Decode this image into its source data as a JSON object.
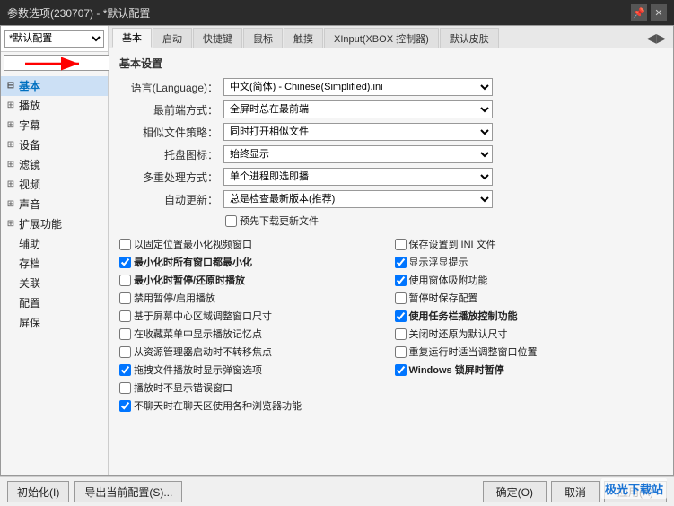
{
  "window": {
    "title": "参数选项(230707) - *默认配置",
    "controls": [
      "pin",
      "close"
    ]
  },
  "left_panel": {
    "profile_select": "*默认配置",
    "search_placeholder": "",
    "nav_items": [
      {
        "id": "basic",
        "label": "基本",
        "expanded": true,
        "selected": true
      },
      {
        "id": "playback",
        "label": "播放",
        "expanded": false
      },
      {
        "id": "subtitle",
        "label": "字幕",
        "expanded": false
      },
      {
        "id": "device",
        "label": "设备",
        "expanded": false
      },
      {
        "id": "filter",
        "label": "滤镜",
        "expanded": false
      },
      {
        "id": "video",
        "label": "视频",
        "expanded": false
      },
      {
        "id": "audio",
        "label": "声音",
        "expanded": false
      },
      {
        "id": "advanced",
        "label": "扩展功能",
        "expanded": false
      },
      {
        "id": "assist",
        "label": "辅助",
        "expanded": false
      },
      {
        "id": "save",
        "label": "存档",
        "expanded": false
      },
      {
        "id": "relate",
        "label": "关联",
        "expanded": false
      },
      {
        "id": "config",
        "label": "配置",
        "expanded": false
      },
      {
        "id": "screensaver",
        "label": "屏保",
        "expanded": false
      }
    ]
  },
  "right_panel": {
    "tabs": [
      "基本",
      "启动",
      "快捷键",
      "鼠标",
      "触摸",
      "XInput(XBOX 控制器)",
      "默认皮肤"
    ],
    "active_tab": "基本",
    "section_title": "基本设置",
    "form_rows": [
      {
        "label": "语言(Language)：",
        "value": "中文(简体) - Chinese(Simplified).ini"
      },
      {
        "label": "最前端方式：",
        "value": "全屏时总在最前端"
      },
      {
        "label": "相似文件策略：",
        "value": "同时打开相似文件"
      },
      {
        "label": "托盘图标：",
        "value": "始终显示"
      },
      {
        "label": "多重处理方式：",
        "value": "单个进程即选即播"
      },
      {
        "label": "自动更新：",
        "value": "总是检查最新版本(推荐)"
      }
    ],
    "pre_download": "预先下载更新文件",
    "checkboxes_left": [
      {
        "label": "以固定位置最小化视频窗口",
        "checked": false
      },
      {
        "label": "最小化时所有窗口都最小化",
        "checked": true,
        "bold": true
      },
      {
        "label": "最小化时暂停/还原时播放",
        "checked": false,
        "bold": true
      },
      {
        "label": "禁用暂停/启用播放",
        "checked": false
      },
      {
        "label": "基于屏幕中心区域调整窗口尺寸",
        "checked": false
      },
      {
        "label": "在收藏菜单中显示播放记忆点",
        "checked": false
      },
      {
        "label": "从资源管理器启动时不转移焦点",
        "checked": false
      },
      {
        "label": "拖拽文件播放时显示弹窗选项",
        "checked": true
      },
      {
        "label": "播放时不显示错误窗口",
        "checked": false
      },
      {
        "label": "不聊天时在聊天区使用各种浏览器功能",
        "checked": true
      }
    ],
    "checkboxes_right": [
      {
        "label": "保存设置到 INI 文件",
        "checked": false
      },
      {
        "label": "显示浮显提示",
        "checked": true
      },
      {
        "label": "使用窗体吸附功能",
        "checked": true
      },
      {
        "label": "暂停时保存配置",
        "checked": false
      },
      {
        "label": "使用任务栏播放控制功能",
        "checked": true,
        "bold": true
      },
      {
        "label": "关闭时还原为默认尺寸",
        "checked": false
      },
      {
        "label": "重复运行时适当调整窗口位置",
        "checked": false
      },
      {
        "label": "Windows 锁屏时暂停",
        "checked": true,
        "bold": true
      }
    ]
  },
  "bottom_bar": {
    "init_btn": "初始化(I)",
    "export_btn": "导出当前配置(S)...",
    "ok_btn": "确定(O)",
    "cancel_btn": "取消",
    "apply_btn": "应用(A)"
  },
  "watermark": "极光下载站"
}
